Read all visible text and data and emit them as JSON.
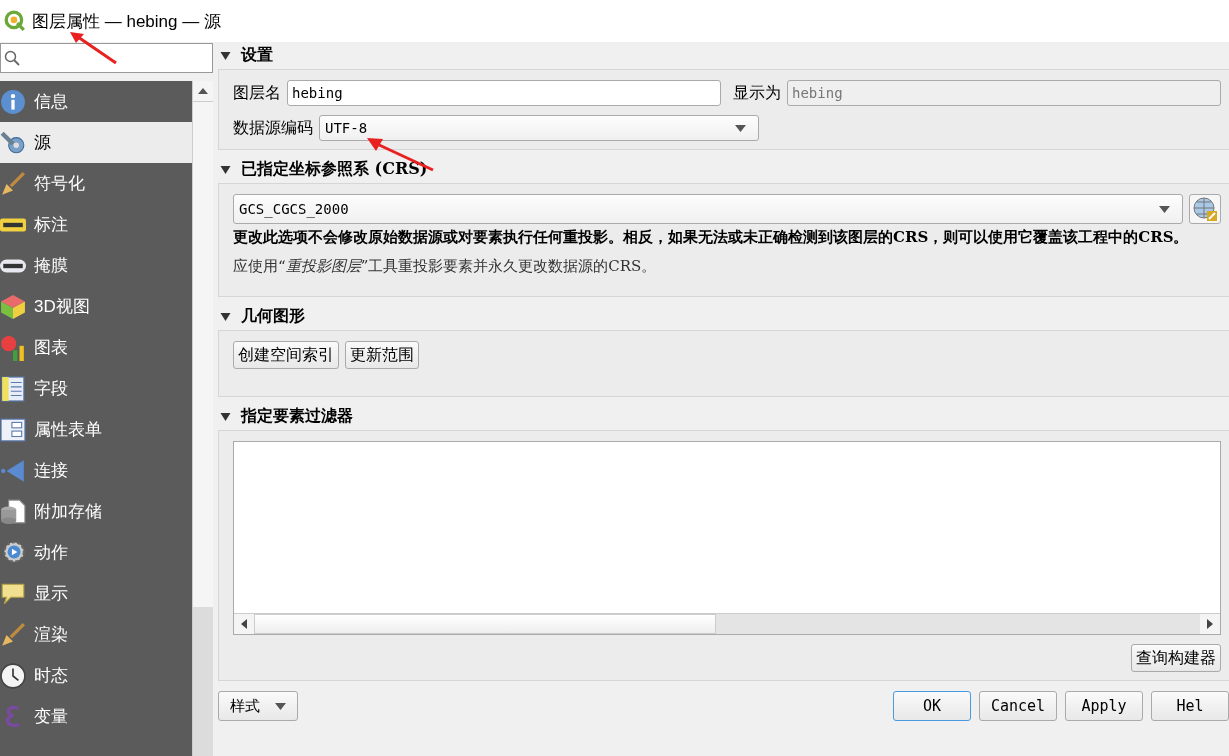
{
  "window": {
    "title": "图层属性 — hebing — 源"
  },
  "sidebar": {
    "items": [
      {
        "label": "信息",
        "kind": "info",
        "selected": false
      },
      {
        "label": "源",
        "kind": "source",
        "selected": true
      },
      {
        "label": "符号化",
        "kind": "brush",
        "selected": false
      },
      {
        "label": "标注",
        "kind": "abc",
        "selected": false
      },
      {
        "label": "掩膜",
        "kind": "abc2",
        "selected": false
      },
      {
        "label": "3D视图",
        "kind": "cube",
        "selected": false
      },
      {
        "label": "图表",
        "kind": "chart",
        "selected": false
      },
      {
        "label": "字段",
        "kind": "fields",
        "selected": false
      },
      {
        "label": "属性表单",
        "kind": "form",
        "selected": false
      },
      {
        "label": "连接",
        "kind": "join",
        "selected": false
      },
      {
        "label": "附加存储",
        "kind": "db",
        "selected": false
      },
      {
        "label": "动作",
        "kind": "gear",
        "selected": false
      },
      {
        "label": "显示",
        "kind": "bubble",
        "selected": false
      },
      {
        "label": "渲染",
        "kind": "brush",
        "selected": false
      },
      {
        "label": "时态",
        "kind": "clock",
        "selected": false
      },
      {
        "label": "变量",
        "kind": "epsilon",
        "selected": false
      }
    ]
  },
  "settings": {
    "title": "设置",
    "expanded": true,
    "layer_name_label": "图层名",
    "layer_name": "hebing",
    "display_as_label": "显示为",
    "display_as": "hebing",
    "encoding_label": "数据源编码",
    "encoding": "UTF-8"
  },
  "crs": {
    "title": "已指定坐标参照系 (CRS)",
    "expanded": true,
    "value": "GCS_CGCS_2000",
    "warning": "更改此选项不会修改原始数据源或对要素执行任何重投影。相反，如果无法或未正确检测到该图层的CRS，则可以使用它覆盖该工程中的CRS。",
    "hint": "应使用“*重投影图层*”工具重投影要素并永久更改数据源的CRS。"
  },
  "geometry": {
    "title": "几何图形",
    "expanded": true,
    "buttons": [
      "创建空间索引",
      "更新范围"
    ]
  },
  "filter": {
    "title": "指定要素过滤器",
    "expanded": true,
    "query_builder": "查询构建器"
  },
  "footer": {
    "style_menu": "样式",
    "buttons": [
      {
        "label": "OK",
        "selected": true
      },
      {
        "label": "Cancel",
        "selected": false
      },
      {
        "label": "Apply",
        "selected": false
      },
      {
        "label": "Hel",
        "selected": false
      }
    ]
  }
}
